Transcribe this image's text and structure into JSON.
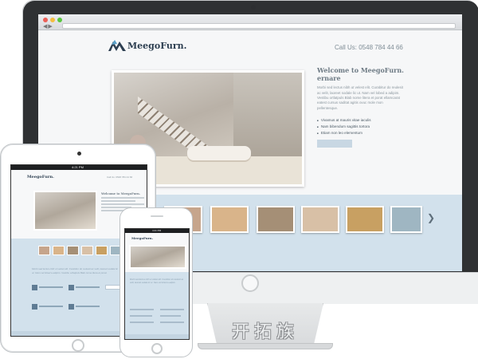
{
  "desktop": {
    "logo_text": "MeegoFurn.",
    "call_text": "Call Us: 0548 784 44 66",
    "welcome_title": "Welcome to MeegoFurn. ernare",
    "welcome_paragraph": "Morbi sed lectus nibh ut velest elit. Curabitur do reulesit ac velit, laoreet sodale lic ut. Nam vel lobed a adipim. Vestibu ortlatpuls Blab nome litera et porat ellamcarat eatest cursus saditat agitis ovuc mole mon pellentesque.",
    "bullets": [
      "Vivamus at mauris vitae iaculis",
      "Nam bibendum sagittis tortora",
      "Etiam non leo elementum"
    ],
    "thumbnail_colors": [
      "#c6a58c",
      "#d9b48a",
      "#a58f76",
      "#d8c0a6",
      "#c8a062",
      "#9fb6c2"
    ]
  },
  "watermark": "开拓族",
  "tablet": {
    "logo_text": "MeegoFurn.",
    "time": "4:21 PM",
    "call_text": "Call Us: 0548 784 44 66",
    "welcome_title": "Welcome to MeegoFurn.",
    "body_text": "Morbi sed lectus nibh ut velest elit. Curabitur do reulesit ac velit, laoreet sodale lic ut. Nam vel lobed a adipim. Vestibu ortlatpuls Blab nome litera et porat."
  },
  "phone": {
    "logo_text": "MeegoFurn.",
    "time": "4:21 PM",
    "body_text": "Morbi sed lectus nibh ut velest elit. Curabitur do reulesit ac velit, laoreet sodale lic ut. Nam vel lobed a adipim."
  }
}
